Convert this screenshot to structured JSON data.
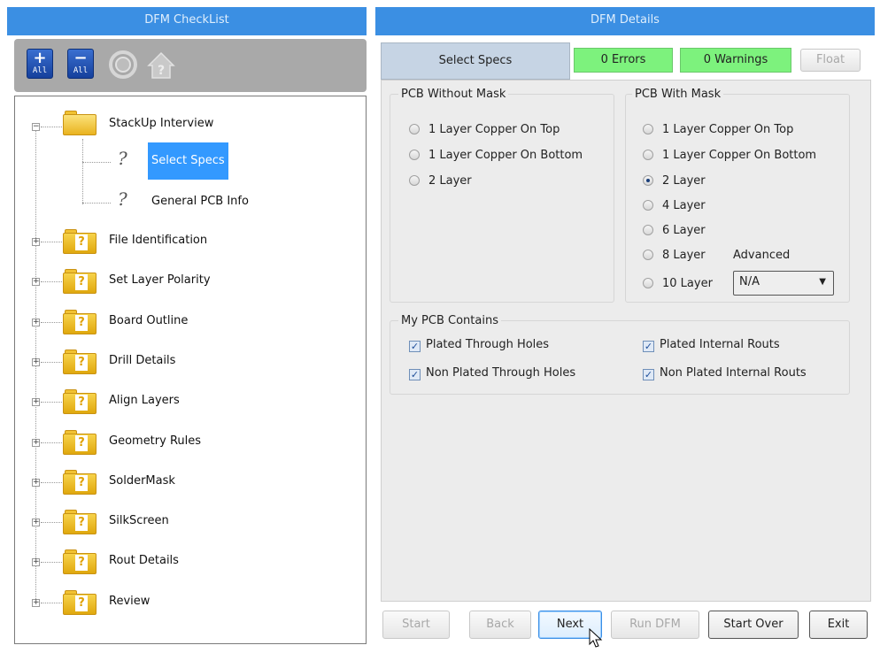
{
  "left_header": "DFM CheckList",
  "right_header": "DFM Details",
  "toolbar": {
    "expand_all_sym": "+",
    "expand_all_sub": "All",
    "collapse_all_sym": "−",
    "collapse_all_sub": "All",
    "icons": [
      "expand-all-icon",
      "collapse-all-icon",
      "circle-arrows-icon",
      "home-help-icon"
    ]
  },
  "tree": {
    "root": "StackUp Interview",
    "children": [
      "Select Specs",
      "General PCB Info"
    ],
    "items": [
      "File Identification",
      "Set Layer Polarity",
      "Board Outline",
      "Drill Details",
      "Align Layers",
      "Geometry Rules",
      "SolderMask",
      "SilkScreen",
      "Rout Details",
      "Review"
    ],
    "folder_q": "?",
    "child_q": "?",
    "exp_minus": "−",
    "exp_plus": "+"
  },
  "tabs": {
    "select_specs": "Select Specs",
    "errors": "0 Errors",
    "warnings": "0 Warnings",
    "float": "Float"
  },
  "pcb_without_mask": {
    "title": "PCB Without Mask",
    "options": [
      "1 Layer Copper On Top",
      "1 Layer Copper On Bottom",
      "2 Layer"
    ]
  },
  "pcb_with_mask": {
    "title": "PCB With Mask",
    "options": [
      "1 Layer Copper On Top",
      "1 Layer Copper On Bottom",
      "2 Layer",
      "4 Layer",
      "6 Layer",
      "8 Layer",
      "10 Layer"
    ],
    "selected": "2 Layer",
    "advanced_label": "Advanced",
    "advanced_value": "N/A"
  },
  "contains": {
    "title": "My PCB Contains",
    "checks": [
      "Plated Through Holes",
      "Plated Internal Routs",
      "Non Plated Through Holes",
      "Non Plated Internal Routs"
    ],
    "check_mark": "✓"
  },
  "buttons": {
    "start": "Start",
    "back": "Back",
    "next": "Next",
    "run_dfm": "Run DFM",
    "start_over": "Start Over",
    "exit": "Exit"
  },
  "colors": {
    "header_blue": "#3b8fe3",
    "selection_blue": "#3399ff",
    "badge_green": "#7df27d"
  }
}
